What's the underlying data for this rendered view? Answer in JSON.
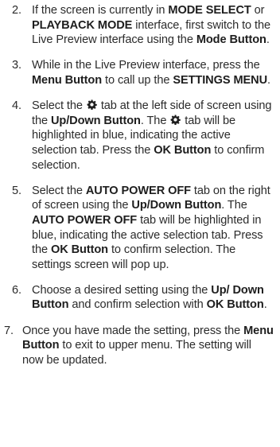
{
  "steps": [
    {
      "number": "2.",
      "segments": [
        {
          "text": "If the screen is currently in ",
          "bold": false
        },
        {
          "text": "MODE SELECT",
          "bold": true
        },
        {
          "text": " or ",
          "bold": false
        },
        {
          "text": "PLAYBACK MODE",
          "bold": true
        },
        {
          "text": " interface, first switch to the Live Preview interface using the ",
          "bold": false
        },
        {
          "text": "Mode Button",
          "bold": true
        },
        {
          "text": ".",
          "bold": false
        }
      ]
    },
    {
      "number": "3.",
      "segments": [
        {
          "text": "While in the Live Preview interface, press the ",
          "bold": false
        },
        {
          "text": "Menu Button",
          "bold": true
        },
        {
          "text": " to call up the ",
          "bold": false
        },
        {
          "text": "SETTINGS MENU",
          "bold": true
        },
        {
          "text": ".",
          "bold": false
        }
      ]
    },
    {
      "number": "4.",
      "segments": [
        {
          "text": "Select the ",
          "bold": false
        },
        {
          "icon": "gear-icon"
        },
        {
          "text": " tab at the left side of screen using the ",
          "bold": false
        },
        {
          "text": "Up/Down Button",
          "bold": true
        },
        {
          "text": ". The ",
          "bold": false
        },
        {
          "icon": "gear-icon"
        },
        {
          "text": " tab will be highlighted in blue, indicating the active selection tab. Press the ",
          "bold": false
        },
        {
          "text": "OK Button",
          "bold": true
        },
        {
          "text": " to confirm selection.",
          "bold": false
        }
      ]
    },
    {
      "number": "5.",
      "segments": [
        {
          "text": "Select the ",
          "bold": false
        },
        {
          "text": "AUTO POWER OFF",
          "bold": true
        },
        {
          "text": " tab on the right of screen using the ",
          "bold": false
        },
        {
          "text": "Up/Down Button",
          "bold": true
        },
        {
          "text": ". The ",
          "bold": false
        },
        {
          "text": "AUTO POWER OFF",
          "bold": true
        },
        {
          "text": " tab will be highlighted in blue, indicating the active selection tab. Press the ",
          "bold": false
        },
        {
          "text": "OK Button",
          "bold": true
        },
        {
          "text": " to confirm selection. The settings screen will pop up.",
          "bold": false
        }
      ]
    },
    {
      "number": "6.",
      "segments": [
        {
          "text": "Choose a desired setting using the ",
          "bold": false
        },
        {
          "text": "Up/ Down Button",
          "bold": true
        },
        {
          "text": " and confirm selection with ",
          "bold": false
        },
        {
          "text": "OK Button",
          "bold": true
        },
        {
          "text": ".",
          "bold": false
        }
      ]
    },
    {
      "number": "7.",
      "outdent": true,
      "segments": [
        {
          "text": "Once you have made the setting, press the ",
          "bold": false
        },
        {
          "text": "Menu Button",
          "bold": true
        },
        {
          "text": " to exit to upper menu. The setting will now be updated.",
          "bold": false
        }
      ]
    }
  ]
}
